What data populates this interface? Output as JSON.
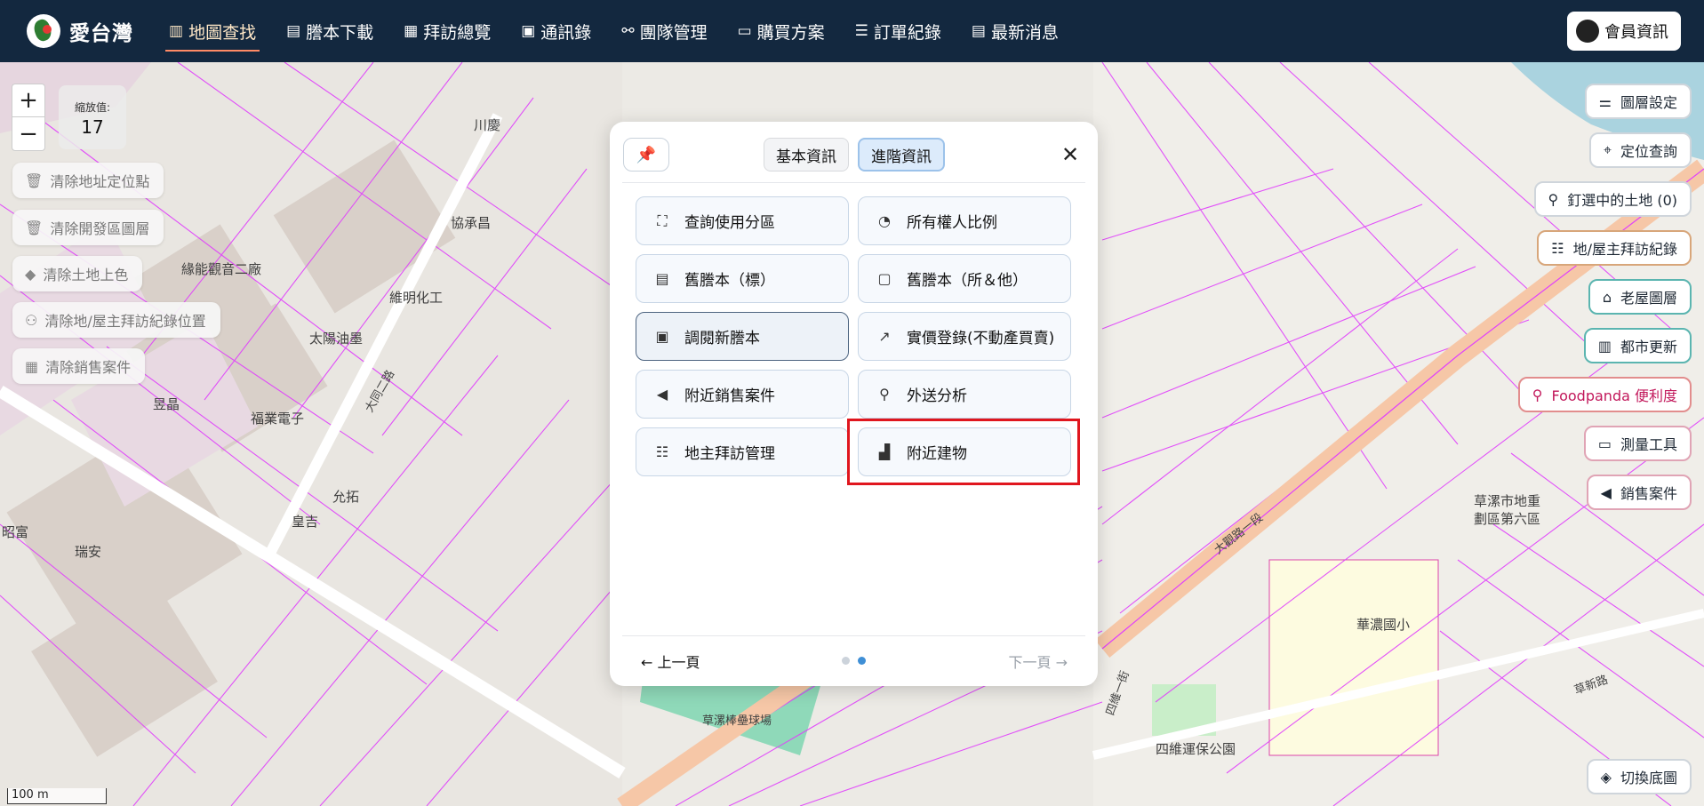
{
  "app": {
    "logo_text": "愛台灣"
  },
  "nav": [
    {
      "label": "地圖查找",
      "icon": "map-icon",
      "glyph": "▥",
      "active": true
    },
    {
      "label": "謄本下載",
      "icon": "document-icon",
      "glyph": "▤"
    },
    {
      "label": "拜訪總覽",
      "icon": "report-icon",
      "glyph": "▦"
    },
    {
      "label": "通訊錄",
      "icon": "contact-card-icon",
      "glyph": "▣"
    },
    {
      "label": "團隊管理",
      "icon": "team-icon",
      "glyph": "⚯"
    },
    {
      "label": "購買方案",
      "icon": "folder-icon",
      "glyph": "▭"
    },
    {
      "label": "訂單紀錄",
      "icon": "receipt-icon",
      "glyph": "☰"
    },
    {
      "label": "最新消息",
      "icon": "news-icon",
      "glyph": "▤"
    }
  ],
  "member": {
    "label": "會員資訊"
  },
  "map": {
    "zoom_in": "+",
    "zoom_out": "−",
    "zoom_title": "縮放值:",
    "zoom_value": "17",
    "scale": "100 m",
    "labels": {
      "hospital": "華濃國小",
      "park": "草漯市地重劃區第六區",
      "pool": "四維運保公園",
      "field": "草漯棒壘球場",
      "road1": "大觀路一段",
      "road2": "大同二路",
      "road3": "四維一街",
      "road4": "草新路",
      "lot1": "太陽油墨",
      "lot2": "福業電子",
      "lot3": "昱晶",
      "lot4": "維明化工",
      "lot5": "緣能觀音二廠",
      "lot6": "協承昌",
      "lot7": "川慶",
      "lot8": "瑞安",
      "lot9": "昭富",
      "lot10": "允拓",
      "lot11": "皇吉"
    }
  },
  "left_controls": [
    {
      "label": "清除地址定位點",
      "icon": "trash-icon",
      "glyph": "🗑"
    },
    {
      "label": "清除開發區圖層",
      "icon": "trash-icon",
      "glyph": "🗑"
    },
    {
      "label": "清除土地上色",
      "icon": "eraser-icon",
      "glyph": "◆"
    },
    {
      "label": "清除地/屋主拜訪紀錄位置",
      "icon": "user-remove-icon",
      "glyph": "⚇"
    },
    {
      "label": "清除銷售案件",
      "icon": "grid-remove-icon",
      "glyph": "▦"
    }
  ],
  "right_controls": [
    {
      "label": "圖層設定",
      "icon": "sliders-icon",
      "glyph": "⚌",
      "style": ""
    },
    {
      "label": "定位查詢",
      "icon": "location-pin-icon",
      "glyph": "⌖",
      "style": ""
    },
    {
      "label": "釘選中的土地 (0)",
      "icon": "user-pin-icon",
      "glyph": "⚲",
      "style": ""
    },
    {
      "label": "地/屋主拜訪紀錄",
      "icon": "visit-record-icon",
      "glyph": "☷",
      "style": "brown"
    },
    {
      "label": "老屋圖層",
      "icon": "house-icon",
      "glyph": "⌂",
      "style": "teal"
    },
    {
      "label": "都市更新",
      "icon": "building-icon",
      "glyph": "▥",
      "style": "teal"
    },
    {
      "label": "Foodpanda 便利度",
      "icon": "bicycle-icon",
      "glyph": "⚲",
      "style": "red"
    },
    {
      "label": "測量工具",
      "icon": "ruler-icon",
      "glyph": "▭",
      "style": "pink"
    },
    {
      "label": "銷售案件",
      "icon": "megaphone-icon",
      "glyph": "◀",
      "style": "pink"
    },
    {
      "label": "切換底圖",
      "icon": "layers-icon",
      "glyph": "◈",
      "style": ""
    }
  ],
  "panel": {
    "pin_icon": "📌",
    "tabs": [
      "基本資訊",
      "進階資訊"
    ],
    "close": "✕",
    "features": [
      {
        "label": "查詢使用分區",
        "icon": "zone-icon",
        "glyph": "⛶"
      },
      {
        "label": "所有權人比例",
        "icon": "pie-chart-icon",
        "glyph": "◔"
      },
      {
        "label": "舊謄本（標）",
        "icon": "old-document-icon",
        "glyph": "▤"
      },
      {
        "label": "舊謄本（所＆他）",
        "icon": "copy-document-icon",
        "glyph": "▢"
      },
      {
        "label": "調閱新謄本",
        "icon": "new-document-icon",
        "glyph": "▣"
      },
      {
        "label": "實價登錄(不動產買賣)",
        "icon": "trend-chart-icon",
        "glyph": "↗"
      },
      {
        "label": "附近銷售案件",
        "icon": "megaphone-icon",
        "glyph": "◀"
      },
      {
        "label": "外送分析",
        "icon": "bicycle-icon",
        "glyph": "⚲"
      },
      {
        "label": "地主拜訪管理",
        "icon": "user-list-icon",
        "glyph": "☷"
      },
      {
        "label": "附近建物",
        "icon": "building-icon",
        "glyph": "▟"
      }
    ],
    "prev": "← 上一頁",
    "next": "下一頁 →"
  }
}
